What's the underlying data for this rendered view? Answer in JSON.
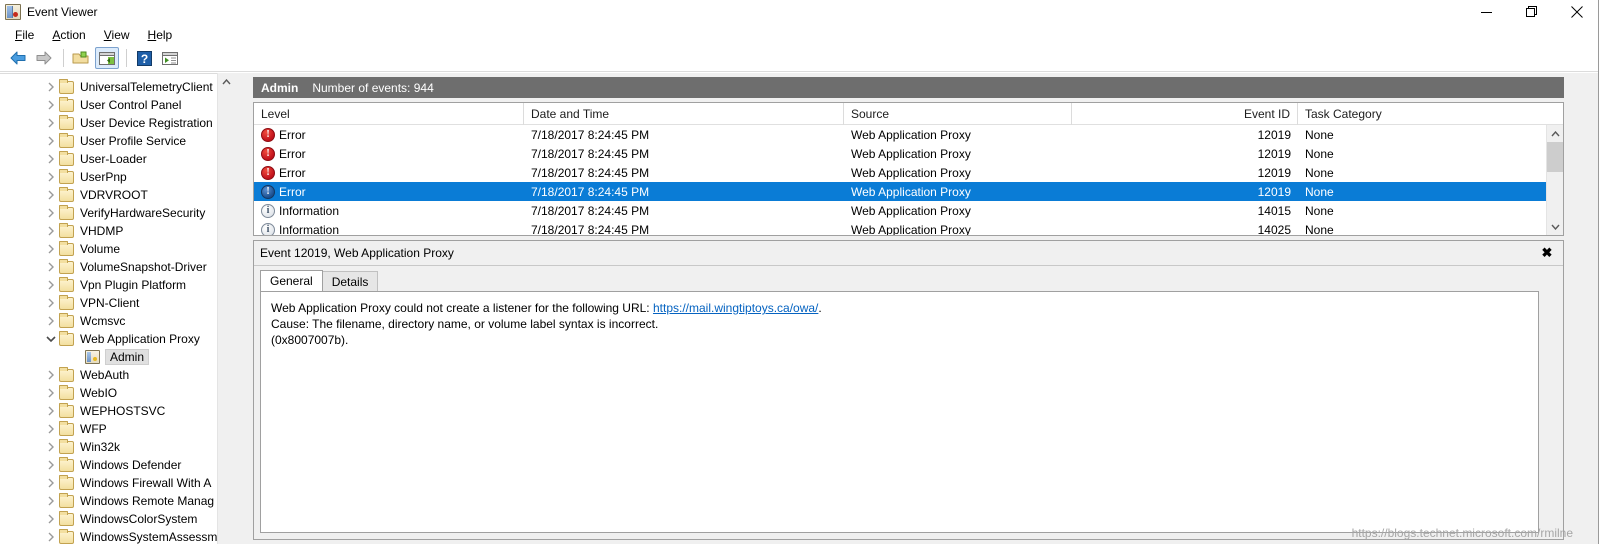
{
  "window": {
    "title": "Event Viewer",
    "app_icon": "event-viewer-icon",
    "minimize_label": "Minimize",
    "maximize_label": "Restore",
    "close_label": "Close"
  },
  "menu": {
    "items": [
      {
        "label": "File",
        "accel": "F"
      },
      {
        "label": "Action",
        "accel": "A"
      },
      {
        "label": "View",
        "accel": "V"
      },
      {
        "label": "Help",
        "accel": "H"
      }
    ]
  },
  "toolbar": {
    "buttons": [
      {
        "name": "back-button",
        "icon": "arrow-left-icon",
        "label": "Back"
      },
      {
        "name": "forward-button",
        "icon": "arrow-right-icon",
        "label": "Forward"
      },
      {
        "name": "show-hide-tree-button",
        "icon": "folder-open-icon",
        "label": "Show/Hide Console Tree"
      },
      {
        "name": "show-hide-action-pane-button",
        "icon": "window-pane-icon",
        "label": "Show/Hide Action Pane"
      },
      {
        "name": "help-button",
        "icon": "question-mark-icon",
        "label": "Help"
      },
      {
        "name": "properties-button",
        "icon": "window-properties-icon",
        "label": "Properties"
      }
    ]
  },
  "tree": {
    "items": [
      {
        "label": "UniversalTelemetryClient",
        "icon": "folder-icon",
        "expanded": false,
        "depth": 1,
        "selected": false
      },
      {
        "label": "User Control Panel",
        "icon": "folder-icon",
        "expanded": false,
        "depth": 1,
        "selected": false
      },
      {
        "label": "User Device Registration",
        "icon": "folder-icon",
        "expanded": false,
        "depth": 1,
        "selected": false
      },
      {
        "label": "User Profile Service",
        "icon": "folder-icon",
        "expanded": false,
        "depth": 1,
        "selected": false
      },
      {
        "label": "User-Loader",
        "icon": "folder-icon",
        "expanded": false,
        "depth": 1,
        "selected": false
      },
      {
        "label": "UserPnp",
        "icon": "folder-icon",
        "expanded": false,
        "depth": 1,
        "selected": false
      },
      {
        "label": "VDRVROOT",
        "icon": "folder-icon",
        "expanded": false,
        "depth": 1,
        "selected": false
      },
      {
        "label": "VerifyHardwareSecurity",
        "icon": "folder-icon",
        "expanded": false,
        "depth": 1,
        "selected": false
      },
      {
        "label": "VHDMP",
        "icon": "folder-icon",
        "expanded": false,
        "depth": 1,
        "selected": false
      },
      {
        "label": "Volume",
        "icon": "folder-icon",
        "expanded": false,
        "depth": 1,
        "selected": false
      },
      {
        "label": "VolumeSnapshot-Driver",
        "icon": "folder-icon",
        "expanded": false,
        "depth": 1,
        "selected": false
      },
      {
        "label": "Vpn Plugin Platform",
        "icon": "folder-icon",
        "expanded": false,
        "depth": 1,
        "selected": false
      },
      {
        "label": "VPN-Client",
        "icon": "folder-icon",
        "expanded": false,
        "depth": 1,
        "selected": false
      },
      {
        "label": "Wcmsvc",
        "icon": "folder-icon",
        "expanded": false,
        "depth": 1,
        "selected": false
      },
      {
        "label": "Web Application Proxy",
        "icon": "folder-icon",
        "expanded": true,
        "depth": 1,
        "selected": false
      },
      {
        "label": "Admin",
        "icon": "event-log-icon",
        "expanded": null,
        "depth": 2,
        "selected": true
      },
      {
        "label": "WebAuth",
        "icon": "folder-icon",
        "expanded": false,
        "depth": 1,
        "selected": false
      },
      {
        "label": "WebIO",
        "icon": "folder-icon",
        "expanded": false,
        "depth": 1,
        "selected": false
      },
      {
        "label": "WEPHOSTSVC",
        "icon": "folder-icon",
        "expanded": false,
        "depth": 1,
        "selected": false
      },
      {
        "label": "WFP",
        "icon": "folder-icon",
        "expanded": false,
        "depth": 1,
        "selected": false
      },
      {
        "label": "Win32k",
        "icon": "folder-icon",
        "expanded": false,
        "depth": 1,
        "selected": false
      },
      {
        "label": "Windows Defender",
        "icon": "folder-icon",
        "expanded": false,
        "depth": 1,
        "selected": false
      },
      {
        "label": "Windows Firewall With A",
        "icon": "folder-icon",
        "expanded": false,
        "depth": 1,
        "selected": false
      },
      {
        "label": "Windows Remote Manag",
        "icon": "folder-icon",
        "expanded": false,
        "depth": 1,
        "selected": false
      },
      {
        "label": "WindowsColorSystem",
        "icon": "folder-icon",
        "expanded": false,
        "depth": 1,
        "selected": false
      },
      {
        "label": "WindowsSystemAssessm",
        "icon": "folder-icon",
        "expanded": false,
        "depth": 1,
        "selected": false
      }
    ]
  },
  "log_banner": {
    "name": "Admin",
    "count_label": "Number of events: 944"
  },
  "list": {
    "columns": [
      {
        "label": "Level",
        "align": "left"
      },
      {
        "label": "Date and Time",
        "align": "left"
      },
      {
        "label": "Source",
        "align": "left"
      },
      {
        "label": "Event ID",
        "align": "right"
      },
      {
        "label": "Task Category",
        "align": "left"
      }
    ],
    "rows": [
      {
        "level": "Error",
        "level_icon": "error-icon",
        "datetime": "7/18/2017 8:24:45 PM",
        "source": "Web Application Proxy",
        "event_id": "12019",
        "task_category": "None",
        "selected": false
      },
      {
        "level": "Error",
        "level_icon": "error-icon",
        "datetime": "7/18/2017 8:24:45 PM",
        "source": "Web Application Proxy",
        "event_id": "12019",
        "task_category": "None",
        "selected": false
      },
      {
        "level": "Error",
        "level_icon": "error-icon",
        "datetime": "7/18/2017 8:24:45 PM",
        "source": "Web Application Proxy",
        "event_id": "12019",
        "task_category": "None",
        "selected": false
      },
      {
        "level": "Error",
        "level_icon": "error-icon",
        "datetime": "7/18/2017 8:24:45 PM",
        "source": "Web Application Proxy",
        "event_id": "12019",
        "task_category": "None",
        "selected": true
      },
      {
        "level": "Information",
        "level_icon": "information-icon",
        "datetime": "7/18/2017 8:24:45 PM",
        "source": "Web Application Proxy",
        "event_id": "14015",
        "task_category": "None",
        "selected": false
      },
      {
        "level": "Information",
        "level_icon": "information-icon",
        "datetime": "7/18/2017 8:24:45 PM",
        "source": "Web Application Proxy",
        "event_id": "14025",
        "task_category": "None",
        "selected": false
      }
    ]
  },
  "detail": {
    "header": "Event 12019, Web Application Proxy",
    "close_glyph": "✖",
    "tabs": [
      {
        "label": "General",
        "active": true
      },
      {
        "label": "Details",
        "active": false
      }
    ],
    "body": {
      "line1_prefix": "Web Application Proxy could not create a listener for the following URL: ",
      "link_text": "https://mail.wingtiptoys.ca/owa/",
      "line1_suffix": ".",
      "line2": "Cause: The filename, directory name, or volume label syntax is incorrect.",
      "line3": "(0x8007007b)."
    }
  },
  "watermark": {
    "text": "https://blogs.technet.microsoft.com/rmilne"
  },
  "colors": {
    "selection_blue": "#0a7cd6",
    "banner_gray": "#6e6e6e",
    "error_red": "#c1111b",
    "link_blue": "#0563c1",
    "window_bg": "#f0f0f0"
  }
}
